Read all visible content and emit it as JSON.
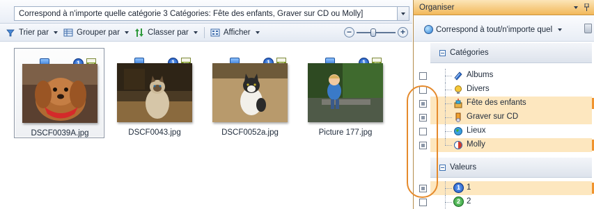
{
  "filter_bar": {
    "text": "Correspond à n'importe quelle catégorie 3 Catégories: Fête des enfants, Graver sur CD ou Molly]"
  },
  "toolbar": {
    "sort_label": "Trier par",
    "group_label": "Grouper par",
    "order_label": "Classer par",
    "view_label": "Afficher"
  },
  "thumbnails": [
    {
      "filename": "DSCF0039A.jpg",
      "selected": true,
      "rating": "1"
    },
    {
      "filename": "DSCF0043.jpg",
      "selected": false,
      "rating": "1"
    },
    {
      "filename": "DSCF0052a.jpg",
      "selected": false,
      "rating": "1"
    },
    {
      "filename": "Picture 177.jpg",
      "selected": false,
      "rating": "1"
    }
  ],
  "organiser": {
    "title": "Organiser",
    "match_label": "Correspond à tout/n'importe quel",
    "categories_header": "Catégories",
    "categories": [
      {
        "label": "Albums",
        "checked": "empty",
        "highlighted": false
      },
      {
        "label": "Divers",
        "checked": "empty",
        "highlighted": false
      },
      {
        "label": "Fête des enfants",
        "checked": "partial",
        "highlighted": true
      },
      {
        "label": "Graver sur CD",
        "checked": "partial",
        "highlighted": true
      },
      {
        "label": "Lieux",
        "checked": "empty",
        "highlighted": false
      },
      {
        "label": "Molly",
        "checked": "partial",
        "highlighted": true
      }
    ],
    "values_header": "Valeurs",
    "values": [
      {
        "label": "1",
        "checked": "partial",
        "highlighted": true,
        "color": "#1b4fb5"
      },
      {
        "label": "2",
        "checked": "empty",
        "highlighted": false,
        "color": "#2e9a3a"
      }
    ]
  },
  "colors": {
    "accent_orange": "#f2b85a",
    "highlight": "#fde7bf",
    "annotation": "#e58a2c"
  }
}
